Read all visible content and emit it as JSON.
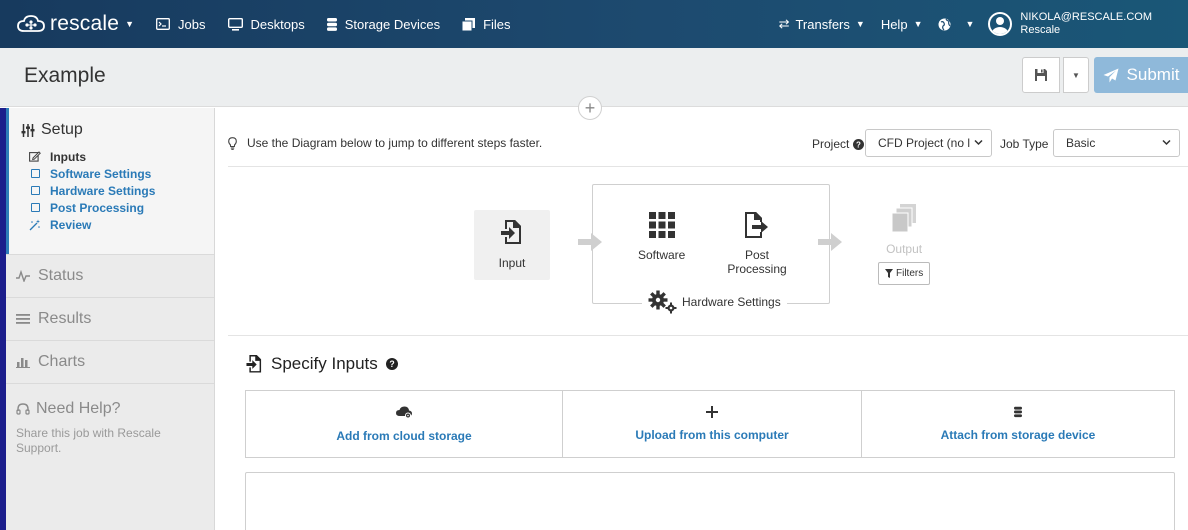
{
  "nav": {
    "brand": "rescale",
    "items": [
      {
        "label": "Jobs",
        "icon": "terminal-icon"
      },
      {
        "label": "Desktops",
        "icon": "monitor-icon"
      },
      {
        "label": "Storage Devices",
        "icon": "database-icon"
      },
      {
        "label": "Files",
        "icon": "files-icon"
      }
    ],
    "transfers": "Transfers",
    "help": "Help",
    "user_email": "NIKOLA@RESCALE.COM",
    "user_org": "Rescale"
  },
  "header": {
    "title": "Example",
    "submit_label": "Submit"
  },
  "sidebar": {
    "setup_title": "Setup",
    "steps": [
      {
        "label": "Inputs",
        "icon": "edit-icon",
        "state": "active"
      },
      {
        "label": "Software Settings",
        "icon": "checkbox-icon",
        "state": "link"
      },
      {
        "label": "Hardware Settings",
        "icon": "checkbox-icon",
        "state": "link"
      },
      {
        "label": "Post Processing",
        "icon": "checkbox-icon",
        "state": "link"
      },
      {
        "label": "Review",
        "icon": "magic-icon",
        "state": "link"
      }
    ],
    "status": "Status",
    "results": "Results",
    "charts": "Charts",
    "help_title": "Need Help?",
    "help_text": "Share this job with Rescale Support."
  },
  "main": {
    "hint": "Use the Diagram below to jump to different steps faster.",
    "project_label": "Project",
    "project_value": "CFD Project (no l",
    "job_type_label": "Job Type",
    "job_type_value": "Basic",
    "diagram": {
      "input": "Input",
      "software": "Software",
      "post_line1": "Post",
      "post_line2": "Processing",
      "hardware": "Hardware Settings",
      "output": "Output",
      "filters": "Filters"
    },
    "specify_title": "Specify Inputs",
    "options": [
      {
        "label": "Add from cloud storage",
        "icon": "cloud-icon"
      },
      {
        "label": "Upload from this computer",
        "icon": "plus-icon"
      },
      {
        "label": "Attach from storage device",
        "icon": "database-icon"
      }
    ]
  },
  "colors": {
    "nav_bg": "#1d4a6f",
    "link_blue": "#2a7ab7",
    "submit_bg": "#8fb9da",
    "frame_bg": "#1c1e8c"
  }
}
